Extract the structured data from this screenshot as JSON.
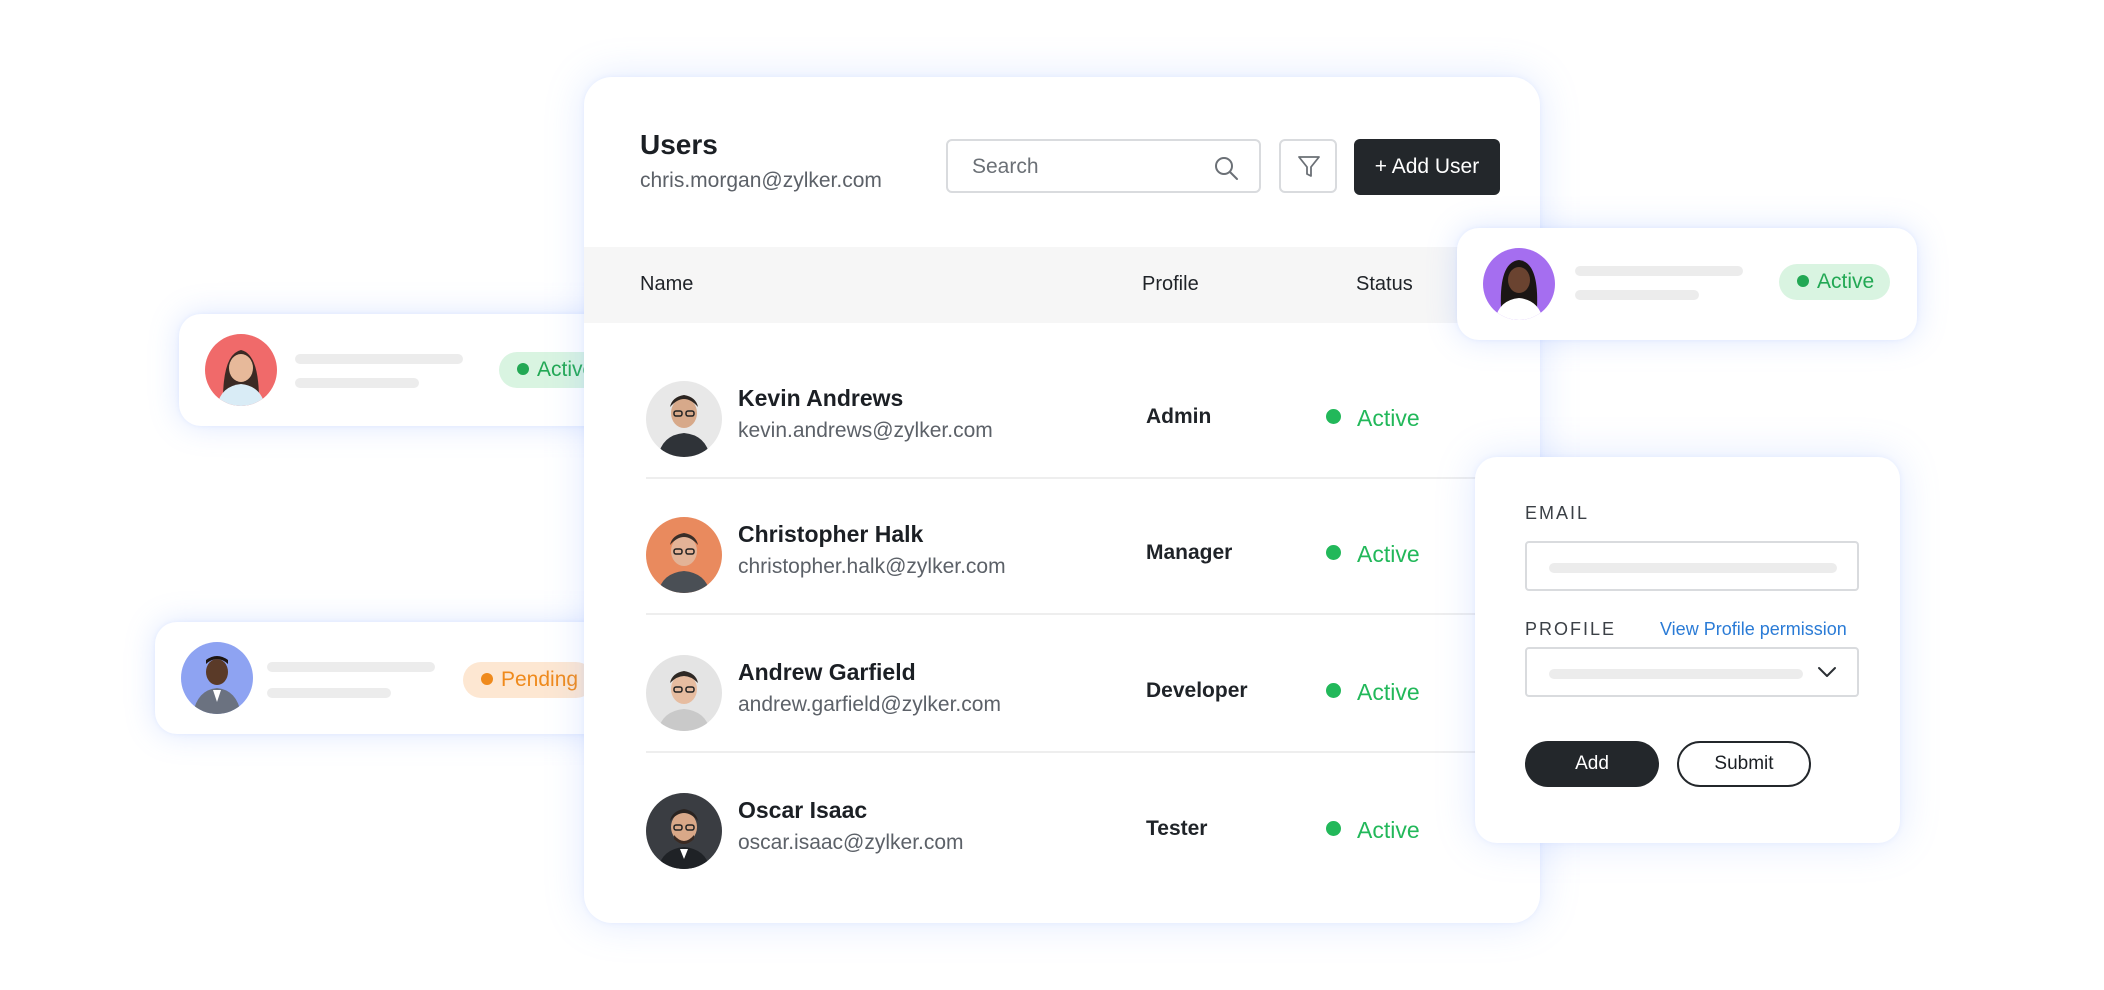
{
  "header": {
    "title": "Users",
    "account_email": "chris.morgan@zylker.com",
    "search_placeholder": "Search",
    "add_user_label": "+ Add User"
  },
  "table": {
    "columns": [
      "Name",
      "Profile",
      "Status"
    ],
    "rows": [
      {
        "name": "Kevin Andrews",
        "email": "kevin.andrews@zylker.com",
        "profile": "Admin",
        "status": "Active"
      },
      {
        "name": "Christopher Halk",
        "email": "christopher.halk@zylker.com",
        "profile": "Manager",
        "status": "Active"
      },
      {
        "name": "Andrew Garfield",
        "email": "andrew.garfield@zylker.com",
        "profile": "Developer",
        "status": "Active"
      },
      {
        "name": "Oscar Isaac",
        "email": "oscar.isaac@zylker.com",
        "profile": "Tester",
        "status": "Active"
      }
    ]
  },
  "floating_cards": [
    {
      "status": "Active"
    },
    {
      "status": "Pending"
    },
    {
      "status": "Active"
    }
  ],
  "form": {
    "email_label": "EMAIL",
    "profile_label": "PROFILE",
    "profile_link": "View Profile permission",
    "add_label": "Add",
    "submit_label": "Submit"
  },
  "colors": {
    "active": "#22b85a",
    "pending": "#ef8a1c",
    "dark_button": "#23272b",
    "link": "#2a7bd6"
  }
}
